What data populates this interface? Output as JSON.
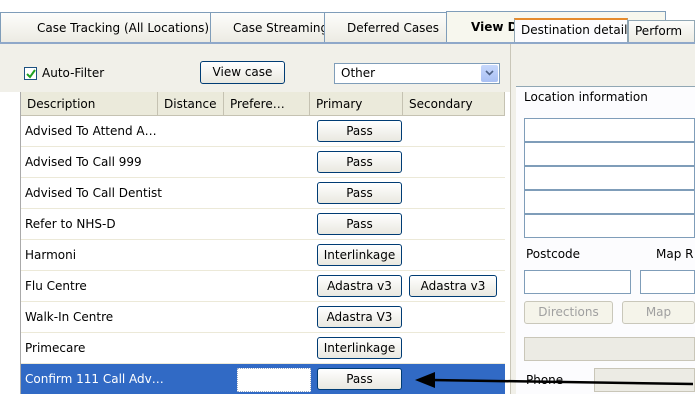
{
  "tabs": [
    {
      "label": "Case Tracking (All Locations)"
    },
    {
      "label": "Case Streaming"
    },
    {
      "label": "Deferred Cases"
    },
    {
      "label": "View Despatch Destinations"
    }
  ],
  "toolbar": {
    "autofilter_label": "Auto-Filter",
    "autofilter_checked": true,
    "view_case_label": "View case",
    "filter_value": "Other"
  },
  "grid": {
    "columns": [
      "Description",
      "Distance",
      "Prefere…",
      "Primary",
      "Secondary"
    ],
    "rows": [
      {
        "description": "Advised To Attend A…",
        "primary": "Pass",
        "secondary": ""
      },
      {
        "description": "Advised To Call 999",
        "primary": "Pass",
        "secondary": ""
      },
      {
        "description": "Advised To Call Dentist",
        "primary": "Pass",
        "secondary": ""
      },
      {
        "description": "Refer to NHS-D",
        "primary": "Pass",
        "secondary": ""
      },
      {
        "description": "Harmoni",
        "primary": "Interlinkage",
        "secondary": ""
      },
      {
        "description": "Flu Centre",
        "primary": "Adastra v3",
        "secondary": "Adastra v3"
      },
      {
        "description": "Walk-In Centre",
        "primary": "Adastra V3",
        "secondary": ""
      },
      {
        "description": "Primecare",
        "primary": "Interlinkage",
        "secondary": ""
      },
      {
        "description": "Confirm 111 Call Adv…",
        "primary": "Pass",
        "secondary": "",
        "selected": true
      }
    ]
  },
  "details": {
    "tabs": [
      "Destination details",
      "Perform"
    ],
    "location_label": "Location information",
    "postcode_label": "Postcode",
    "map_label": "Map R",
    "directions_label": "Directions",
    "map_button_label": "Map",
    "phone_label": "Phone"
  },
  "colors": {
    "selection": "#316ac5",
    "active_tab_accent": "#e68b2c",
    "border_blue": "#7f9db9"
  }
}
